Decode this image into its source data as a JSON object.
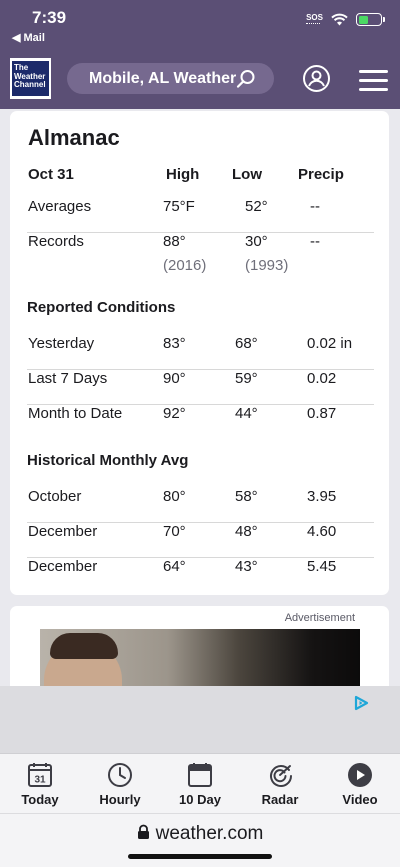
{
  "status_bar": {
    "time": "7:39",
    "back_label": "◀ Mail",
    "sos": "SOS"
  },
  "header": {
    "logo_lines": [
      "The",
      "Weather",
      "Channel"
    ],
    "search_text": "Mobile, AL Weather"
  },
  "almanac": {
    "title": "Almanac",
    "columns": [
      "Oct 31",
      "High",
      "Low",
      "Precip"
    ],
    "rows": [
      {
        "label": "Averages",
        "high": "75°F",
        "low": "52°",
        "precip": "--"
      },
      {
        "label": "Records",
        "high": "88°",
        "low": "30°",
        "precip": "--",
        "high_year": "(2016)",
        "low_year": "(1993)"
      }
    ],
    "reported_title": "Reported Conditions",
    "reported": [
      {
        "label": "Yesterday",
        "high": "83°",
        "low": "68°",
        "precip": "0.02 in"
      },
      {
        "label": "Last 7 Days",
        "high": "90°",
        "low": "59°",
        "precip": "0.02"
      },
      {
        "label": "Month to Date",
        "high": "92°",
        "low": "44°",
        "precip": "0.87"
      }
    ],
    "historical_title": "Historical Monthly Avg",
    "historical": [
      {
        "label": "October",
        "high": "80°",
        "low": "58°",
        "precip": "3.95"
      },
      {
        "label": "December",
        "high": "70°",
        "low": "48°",
        "precip": "4.60"
      },
      {
        "label": "December",
        "high": "64°",
        "low": "43°",
        "precip": "5.45"
      }
    ]
  },
  "ad": {
    "label": "Advertisement"
  },
  "bottom_nav": [
    {
      "label": "Today",
      "icon": "calendar-day-icon",
      "day": "31"
    },
    {
      "label": "Hourly",
      "icon": "clock-icon"
    },
    {
      "label": "10 Day",
      "icon": "calendar-icon"
    },
    {
      "label": "Radar",
      "icon": "radar-icon"
    },
    {
      "label": "Video",
      "icon": "play-icon"
    }
  ],
  "url_bar": {
    "domain": "weather.com"
  }
}
